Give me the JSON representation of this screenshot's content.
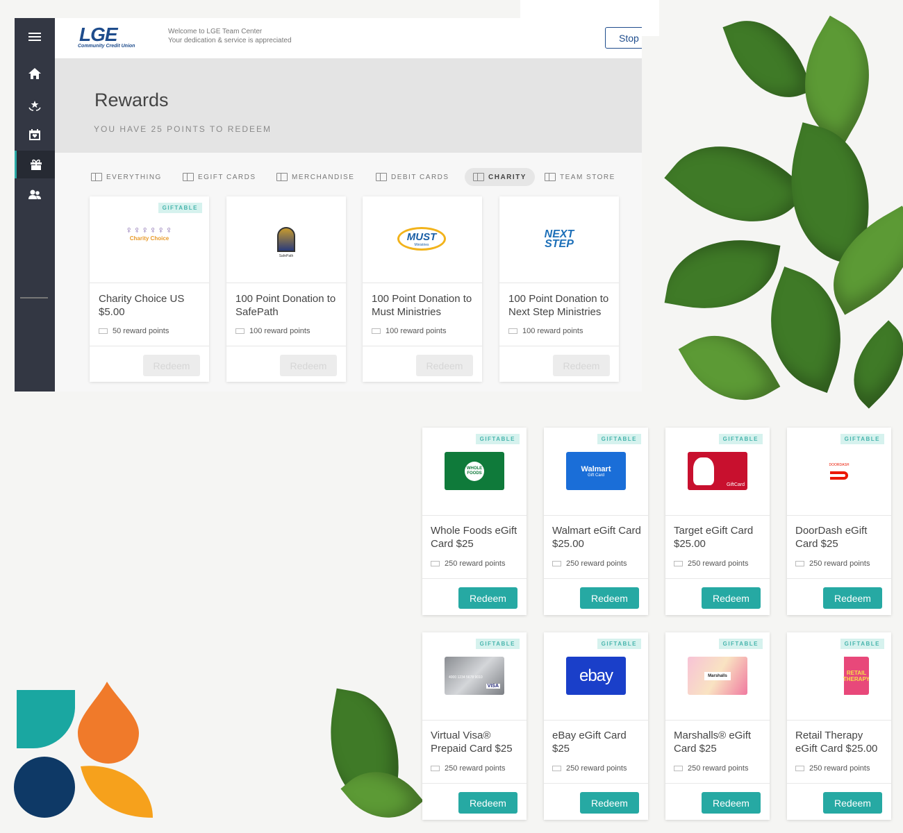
{
  "brand": {
    "logo_text": "LGE",
    "logo_sub": "Community Credit Union",
    "accent": "#26a9a3",
    "navy": "#1e4c8c"
  },
  "header": {
    "welcome_line1": "Welcome to LGE Team Center",
    "welcome_line2": "Your dedication & service is appreciated",
    "stop_label": "Stop"
  },
  "hero": {
    "title": "Rewards",
    "points_text": "YOU HAVE 25 POINTS TO REDEEM"
  },
  "tabs": [
    {
      "label": "EVERYTHING",
      "active": false
    },
    {
      "label": "EGIFT CARDS",
      "active": false
    },
    {
      "label": "MERCHANDISE",
      "active": false
    },
    {
      "label": "DEBIT CARDS",
      "active": false
    },
    {
      "label": "CHARITY",
      "active": true
    },
    {
      "label": "TEAM STORE",
      "active": false
    }
  ],
  "charity_cards": [
    {
      "name": "Charity Choice US $5.00",
      "points": "50 reward points",
      "giftable": "GIFTABLE",
      "redeem": "Redeem",
      "logo": "Charity Choice"
    },
    {
      "name": "100 Point Donation to SafePath",
      "points": "100 reward points",
      "redeem": "Redeem",
      "logo": "SafePath"
    },
    {
      "name": "100 Point Donation to Must Ministries",
      "points": "100 reward points",
      "redeem": "Redeem",
      "logo": "MUST",
      "logo_sub": "Ministries"
    },
    {
      "name": "100 Point Donation to Next Step Ministries",
      "points": "100 reward points",
      "redeem": "Redeem",
      "logo": "NEXT STEP"
    }
  ],
  "gift_cards": [
    {
      "name": "Whole Foods eGift Card $25",
      "points": "250 reward points",
      "giftable": "GIFTABLE",
      "redeem": "Redeem",
      "card_text": "WHOLE FOODS"
    },
    {
      "name": "Walmart eGift Card $25.00",
      "points": "250 reward points",
      "giftable": "GIFTABLE",
      "redeem": "Redeem",
      "card_text": "Walmart",
      "card_sub": "Gift Card"
    },
    {
      "name": "Target eGift Card $25.00",
      "points": "250 reward points",
      "giftable": "GIFTABLE",
      "redeem": "Redeem",
      "card_text": "GiftCard"
    },
    {
      "name": "DoorDash eGift Card $25",
      "points": "250 reward points",
      "giftable": "GIFTABLE",
      "redeem": "Redeem",
      "card_text": "DOORDASH"
    },
    {
      "name": "Virtual Visa® Prepaid Card $25",
      "points": "250 reward points",
      "giftable": "GIFTABLE",
      "redeem": "Redeem",
      "card_text": "VISA",
      "card_number": "4000 1234 5678 9010"
    },
    {
      "name": "eBay eGift Card $25",
      "points": "250 reward points",
      "giftable": "GIFTABLE",
      "redeem": "Redeem",
      "card_text": "ebay"
    },
    {
      "name": "Marshalls® eGift Card $25",
      "points": "250 reward points",
      "giftable": "GIFTABLE",
      "redeem": "Redeem",
      "card_text": "Marshalls"
    },
    {
      "name": "Retail Therapy eGift Card $25.00",
      "points": "250 reward points",
      "giftable": "GIFTABLE",
      "redeem": "Redeem",
      "card_text": "RETAIL THERAPY"
    }
  ]
}
